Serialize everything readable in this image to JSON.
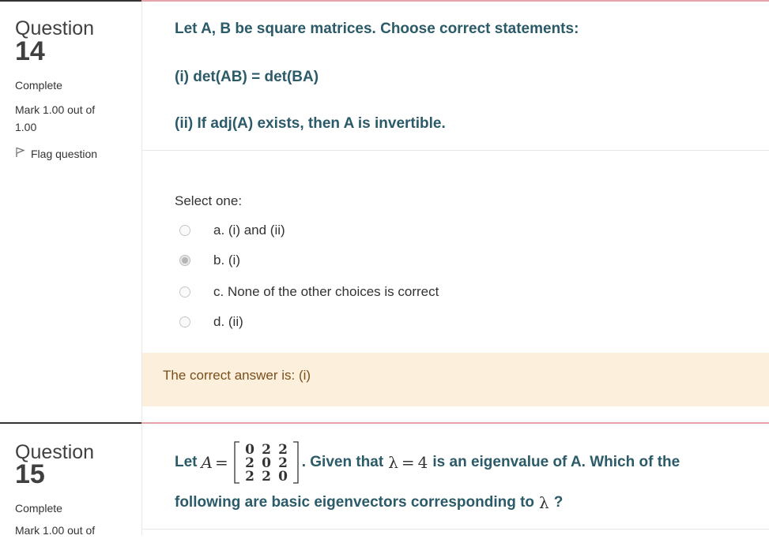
{
  "questions": [
    {
      "question_word": "Question",
      "number": "14",
      "state": "Complete",
      "grade": "Mark 1.00 out of 1.00",
      "flag_label": "Flag question",
      "text_lines": [
        "Let A, B be square matrices. Choose correct statements:",
        "(i) det(AB) = det(BA)",
        "(ii) If adj(A) exists, then A is invertible."
      ],
      "prompt": "Select one:",
      "options": [
        {
          "label": "a. (i) and (ii)",
          "selected": false
        },
        {
          "label": "b. (i)",
          "selected": true
        },
        {
          "label": "c. None of the other choices is correct",
          "selected": false
        },
        {
          "label": "d. (ii)",
          "selected": false
        }
      ],
      "feedback": "The correct answer is: (i)"
    },
    {
      "question_word": "Question",
      "number": "15",
      "state": "Complete",
      "grade": "Mark 1.00 out of",
      "text": {
        "let": "Let",
        "matrix_var": "A",
        "equals": "=",
        "matrix_rows": [
          [
            "0",
            "2",
            "2"
          ],
          [
            "2",
            "0",
            "2"
          ],
          [
            "2",
            "2",
            "0"
          ]
        ],
        "after_matrix": ". Given that",
        "lambda": "λ",
        "eq": "=",
        "eigenvalue": "4",
        "after_eigen": "is an eigenvalue of A. Which of the",
        "line2": "following are basic eigenvectors corresponding to",
        "line2_end": "?"
      }
    }
  ],
  "colors": {
    "question_text": "#2b5a68",
    "feedback_bg": "#fcefdc",
    "feedback_text": "#7a4f1c",
    "separator_red": "#e6a3aa"
  }
}
